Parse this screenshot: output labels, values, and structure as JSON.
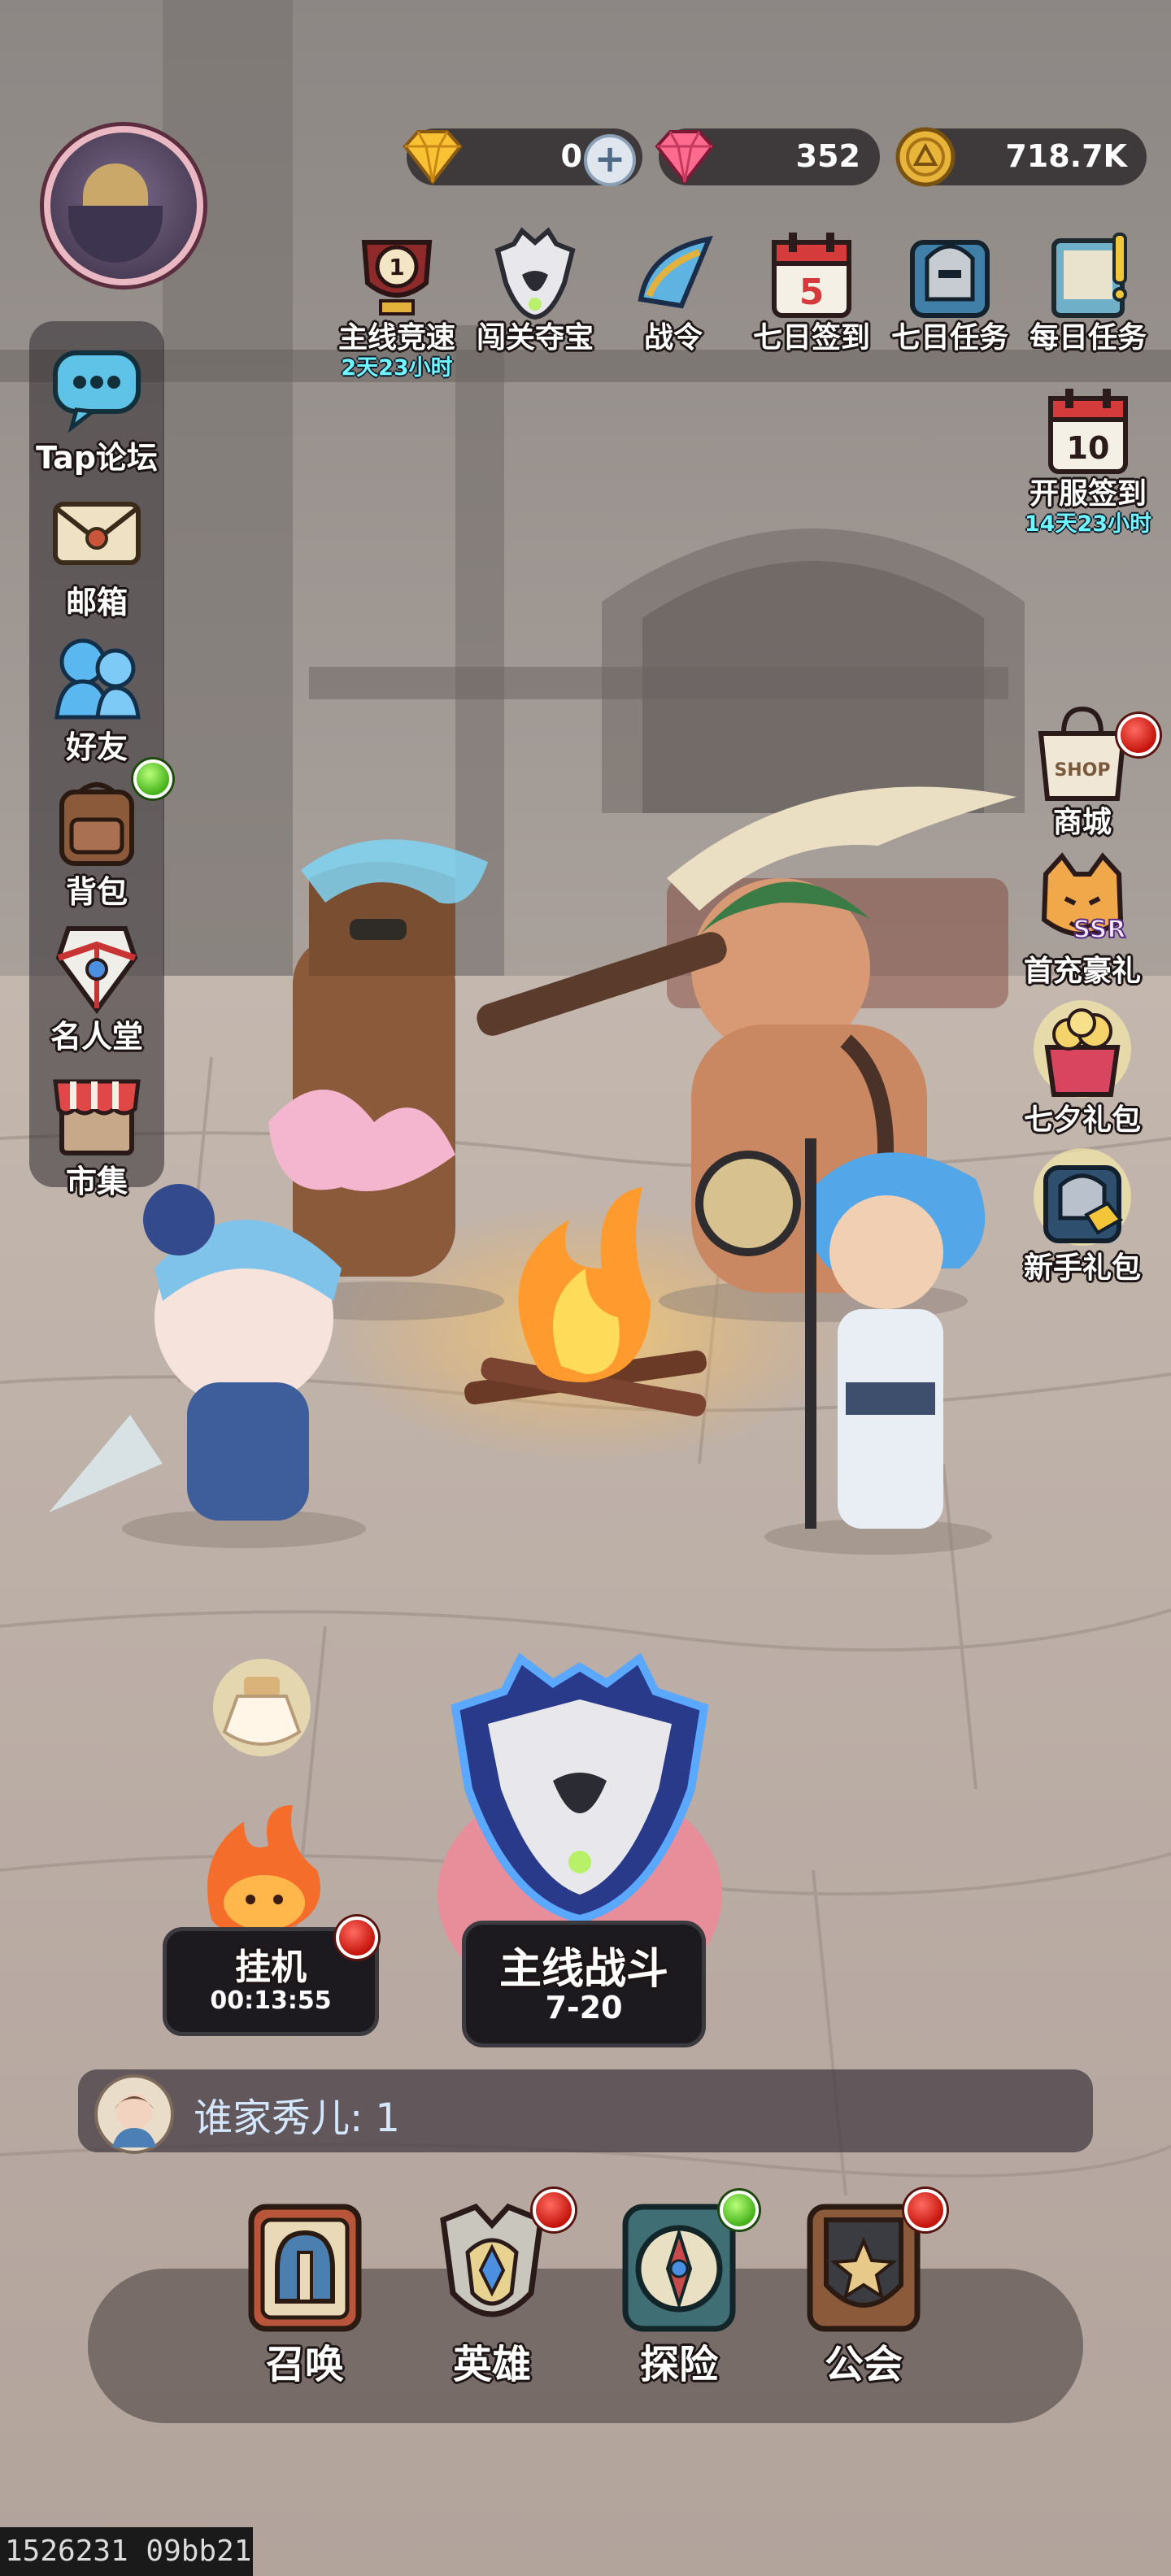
{
  "currencies": {
    "diamond": {
      "icon": "yellow-diamond-icon",
      "value": "0"
    },
    "gem": {
      "icon": "pink-gem-icon",
      "value": "352"
    },
    "gold": {
      "icon": "gold-coin-icon",
      "value": "718.7K"
    }
  },
  "top_events": [
    {
      "icon": "trophy-icon",
      "label": "主线竞速",
      "timer": "2天23小时"
    },
    {
      "icon": "wolf-mask-icon",
      "label": "闯关夺宝"
    },
    {
      "icon": "war-horn-icon",
      "label": "战令"
    },
    {
      "icon": "calendar-icon",
      "label": "七日签到"
    },
    {
      "icon": "helmet-task-icon",
      "label": "七日任务"
    },
    {
      "icon": "task-book-icon",
      "label": "每日任务"
    }
  ],
  "server_signin": {
    "icon": "calendar-icon",
    "label": "开服签到",
    "timer": "14天23小时"
  },
  "left_menu": [
    {
      "icon": "chat-bubble-icon",
      "label": "Tap论坛"
    },
    {
      "icon": "mail-icon",
      "label": "邮箱"
    },
    {
      "icon": "friends-icon",
      "label": "好友"
    },
    {
      "icon": "backpack-icon",
      "label": "背包"
    },
    {
      "icon": "hall-of-fame-icon",
      "label": "名人堂"
    },
    {
      "icon": "market-stall-icon",
      "label": "市集"
    }
  ],
  "right_menu": [
    {
      "icon": "shop-bag-icon",
      "label": "商城",
      "shop_text": "SHOP"
    },
    {
      "icon": "tiger-ssr-icon",
      "label": "首充豪礼",
      "badge": "SSR"
    },
    {
      "icon": "gift-box-icon",
      "label": "七夕礼包"
    },
    {
      "icon": "newbie-pack-icon",
      "label": "新手礼包"
    }
  ],
  "idle": {
    "label": "挂机",
    "timer": "00:13:55"
  },
  "battle": {
    "label": "主线战斗",
    "stage": "7-20"
  },
  "chat": {
    "message": "谁家秀儿: 1"
  },
  "bottom_nav": [
    {
      "icon": "summon-helmet-icon",
      "label": "召唤"
    },
    {
      "icon": "hero-crest-icon",
      "label": "英雄"
    },
    {
      "icon": "compass-icon",
      "label": "探险"
    },
    {
      "icon": "guild-star-icon",
      "label": "公会"
    }
  ],
  "watermark": "1526231 09bb21",
  "colors": {
    "label_text": "#ffffff",
    "timer_text": "#6ff7ff",
    "chat_text": "#d3e7ff",
    "badge_red": "#d8261b",
    "badge_green": "#56c92a"
  }
}
